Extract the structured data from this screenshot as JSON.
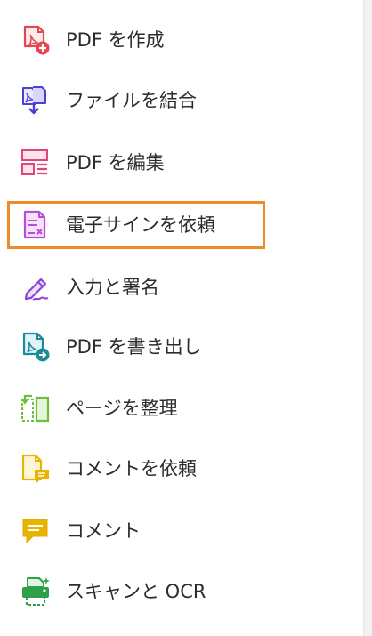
{
  "tools": [
    {
      "id": "create-pdf",
      "label": "PDF を作成",
      "icon": "create-pdf-icon",
      "color": "#e34850"
    },
    {
      "id": "combine-files",
      "label": "ファイルを結合",
      "icon": "combine-files-icon",
      "color": "#4b3fd8"
    },
    {
      "id": "edit-pdf",
      "label": "PDF を編集",
      "icon": "edit-pdf-icon",
      "color": "#e0457b"
    },
    {
      "id": "request-signature",
      "label": "電子サインを依頼",
      "icon": "request-signature-icon",
      "color": "#b84ed6",
      "selected": true
    },
    {
      "id": "fill-sign",
      "label": "入力と署名",
      "icon": "fill-sign-icon",
      "color": "#8b43d8"
    },
    {
      "id": "export-pdf",
      "label": "PDF を書き出し",
      "icon": "export-pdf-icon",
      "color": "#1d8a99"
    },
    {
      "id": "organize-pages",
      "label": "ページを整理",
      "icon": "organize-pages-icon",
      "color": "#6fbf3a"
    },
    {
      "id": "send-for-comments",
      "label": "コメントを依頼",
      "icon": "send-for-comments-icon",
      "color": "#e8b400"
    },
    {
      "id": "comment",
      "label": "コメント",
      "icon": "comment-icon",
      "color": "#e8b400"
    },
    {
      "id": "scan-ocr",
      "label": "スキャンと OCR",
      "icon": "scan-ocr-icon",
      "color": "#2ea04a"
    }
  ],
  "selection_color": "#f08a28"
}
